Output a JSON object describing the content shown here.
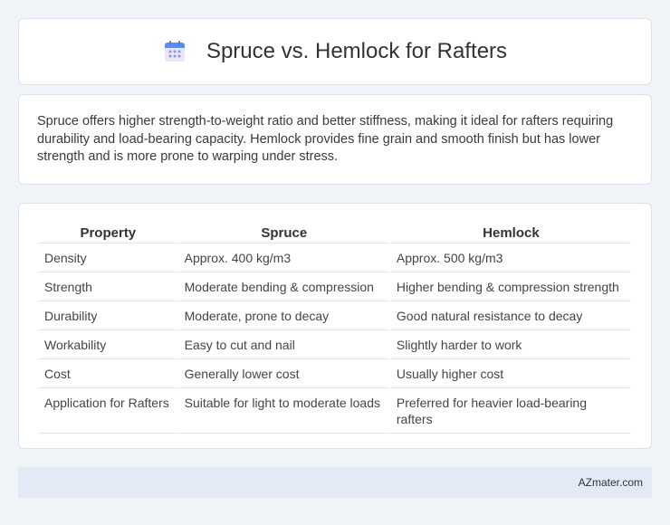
{
  "header": {
    "title": "Spruce vs. Hemlock for Rafters",
    "icon": "calendar-icon"
  },
  "summary": {
    "text": "Spruce offers higher strength-to-weight ratio and better stiffness, making it ideal for rafters requiring durability and load-bearing capacity. Hemlock provides fine grain and smooth finish but has lower strength and is more prone to warping under stress."
  },
  "table": {
    "headers": [
      "Property",
      "Spruce",
      "Hemlock"
    ],
    "rows": [
      [
        "Density",
        "Approx. 400 kg/m3",
        "Approx. 500 kg/m3"
      ],
      [
        "Strength",
        "Moderate bending & compression",
        "Higher bending & compression strength"
      ],
      [
        "Durability",
        "Moderate, prone to decay",
        "Good natural resistance to decay"
      ],
      [
        "Workability",
        "Easy to cut and nail",
        "Slightly harder to work"
      ],
      [
        "Cost",
        "Generally lower cost",
        "Usually higher cost"
      ],
      [
        "Application for Rafters",
        "Suitable for light to moderate loads",
        "Preferred for heavier load-bearing rafters"
      ]
    ]
  },
  "footer": {
    "brand": "AZmater.com"
  },
  "colors": {
    "page_background": "#f0f3f8",
    "card_background": "#ffffff",
    "footer_background": "#e3eaf6"
  }
}
